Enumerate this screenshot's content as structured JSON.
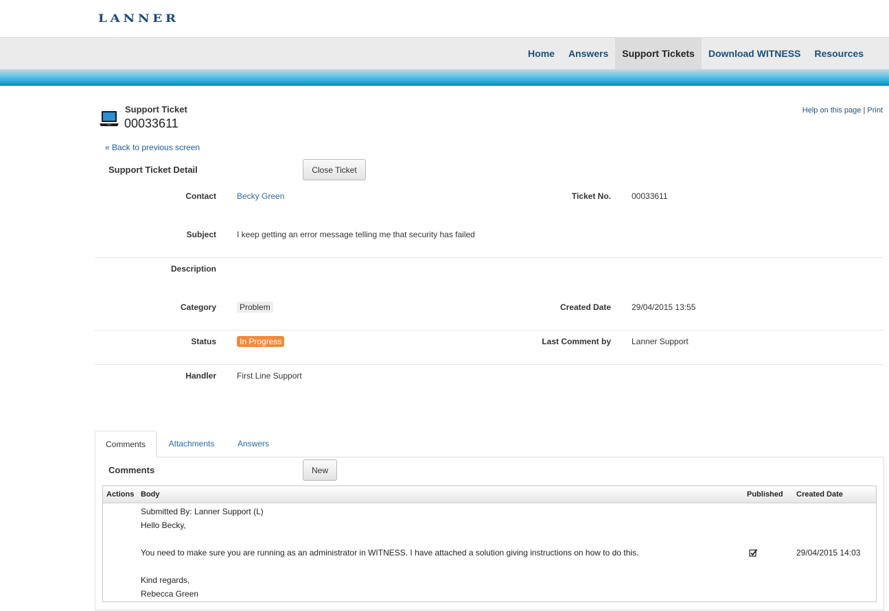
{
  "brand": {
    "logo_text": "LANNER"
  },
  "nav": {
    "items": [
      "Home",
      "Answers",
      "Support Tickets",
      "Download WITNESS",
      "Resources"
    ],
    "active": "Support Tickets"
  },
  "header": {
    "label": "Support Ticket",
    "number": "00033611",
    "help_link": "Help on this page",
    "separator": "|",
    "print_link": "Print"
  },
  "back_link": "« Back to previous screen",
  "detail": {
    "title": "Support Ticket Detail",
    "close_button": "Close Ticket",
    "contact": {
      "label": "Contact",
      "value": "Becky Green"
    },
    "ticket_no": {
      "label": "Ticket No.",
      "value": "00033611"
    },
    "subject": {
      "label": "Subject",
      "value": "I keep getting an error message telling me that security has failed"
    },
    "description": {
      "label": "Description",
      "value": ""
    },
    "category": {
      "label": "Category",
      "value": "Problem"
    },
    "created_date": {
      "label": "Created Date",
      "value": "29/04/2015 13:55"
    },
    "status": {
      "label": "Status",
      "value": "In Progress"
    },
    "last_comment_by": {
      "label": "Last Comment by",
      "value": "Lanner Support"
    },
    "handler": {
      "label": "Handler",
      "value": "First Line Support"
    }
  },
  "tabs": [
    "Comments",
    "Attachments",
    "Answers"
  ],
  "comments": {
    "title": "Comments",
    "new_button": "New",
    "columns": {
      "actions": "Actions",
      "body": "Body",
      "published": "Published",
      "created": "Created Date"
    },
    "rows": [
      {
        "body_lines": [
          "Submitted By: Lanner Support (L)",
          "Hello Becky,",
          "",
          "You need to make sure you are running as an administrator in WITNESS. I have attached a solution giving instructions on how to do this.",
          "",
          "Kind regards,",
          "Rebecca Green"
        ],
        "published": true,
        "created": "29/04/2015 14:03"
      }
    ]
  },
  "colors": {
    "link": "#1a4f7a",
    "status_orange": "#f08a3c",
    "band_blue": "#2fb3e0"
  }
}
